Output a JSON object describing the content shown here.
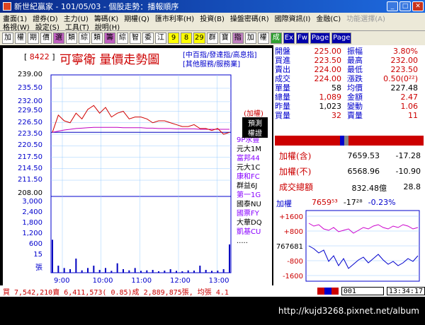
{
  "window": {
    "title": "新世紀贏家 - 101/05/03 - 個股走勢：播報順序"
  },
  "menu": {
    "row1": [
      "畫面(1)",
      "證券(D)",
      "主力(U)",
      "籌碼(K)",
      "期權(Q)",
      "匯市利率(H)",
      "投資(B)",
      "操盤密碼(R)",
      "國際資訊(I)",
      "金融(C)",
      "功能選擇(A)"
    ],
    "row1_dim": "功能選擇(A)",
    "row2": [
      "格視(W)",
      "設定(S)",
      "工具(T)",
      "說明(H)"
    ]
  },
  "toolbar": {
    "buttons": [
      "加",
      "權",
      "期",
      "價",
      "選",
      "類",
      "綜",
      "類",
      "籌",
      "綜",
      "智",
      "委",
      "江",
      "9",
      "8",
      "29",
      "群",
      "寶",
      "指",
      "加",
      "權",
      "成",
      "Ex",
      "Fw",
      "Page",
      "Page"
    ]
  },
  "stock": {
    "code": "8422",
    "name_title": "可寧衛  量價走勢圖",
    "links": [
      "[中百指/發達指/高息指]",
      "[其他服務/服務業]"
    ]
  },
  "chart_data": {
    "type": "line",
    "title": "可寧衛  量價走勢圖",
    "price_ticks": [
      "239.00",
      "235.50",
      "232.00",
      "229.50",
      "226.50",
      "223.50",
      "220.50",
      "217.50",
      "214.50",
      "211.50",
      "208.00"
    ],
    "volume_ticks": [
      "3,000",
      "2,400",
      "1,800",
      "1,200",
      "600",
      "15",
      "張"
    ],
    "x_ticks": [
      "9:00",
      "10:00",
      "11:00",
      "12:00",
      "13:00"
    ],
    "ylim": [
      208,
      239
    ],
    "ref_price": 224,
    "price": [
      224,
      228.5,
      227,
      226.5,
      229,
      227.5,
      230,
      231,
      229,
      230.5,
      228,
      229,
      229.5,
      227.5,
      228,
      228,
      227.5,
      226.5,
      227,
      227,
      226.5,
      226,
      225.5,
      225.5,
      226,
      225,
      225,
      224.5,
      225,
      223.5,
      224
    ],
    "avg": [
      224,
      224.3,
      224.6,
      224.8,
      225.0,
      225.1,
      225.2,
      225.3,
      225.3,
      225.3,
      225.3,
      225.3,
      225.2,
      225.2,
      225.2,
      225.2,
      225.1,
      225.1,
      225.0,
      225.0,
      225.0,
      224.9,
      224.9,
      224.9,
      224.9,
      224.8,
      224.8,
      224.8,
      224.8,
      224.8,
      224.8
    ],
    "volume": [
      1400,
      300,
      200,
      150,
      600,
      100,
      200,
      300,
      120,
      200,
      80,
      400,
      150,
      100,
      200,
      80,
      100,
      120,
      60,
      90,
      150,
      80,
      60,
      100,
      90,
      300,
      120,
      80,
      90,
      150,
      1200
    ],
    "vmax": 3000
  },
  "side_list": [
    "9P永豐",
    "元大1M",
    "富邦44",
    "元大1C",
    "康和FC",
    "群益6J",
    "第一1G",
    "國泰NU",
    "國票FY",
    "大華DQ",
    "凱基CU",
    "....."
  ],
  "side_heads": [
    "(加權)",
    "預測",
    "權證"
  ],
  "quote": [
    [
      "開盤",
      "225.00",
      "振幅",
      "3.80%"
    ],
    [
      "買進",
      "223.50",
      "最高",
      "232.00"
    ],
    [
      "賣出",
      "224.00",
      "最低",
      "223.50"
    ],
    [
      "成交",
      "224.00",
      "漲跌",
      "0.50(0²²)"
    ],
    [
      "單量",
      "58",
      "均價",
      "227.48"
    ],
    [
      "總量",
      "1,089",
      "金額",
      "2.47"
    ],
    [
      "昨量",
      "1,023",
      "變動",
      "1.06"
    ],
    [
      "買量",
      "32",
      "賣量",
      "11"
    ]
  ],
  "index": [
    {
      "label": "加權(含)",
      "v1": "7659.53",
      "v2": "-17.28"
    },
    {
      "label": "加權(不)",
      "v1": "6568.96",
      "v2": "-10.90"
    },
    {
      "label": "成交總額",
      "v1": "832.48億",
      "v2": "28.8"
    }
  ],
  "mini": {
    "label": "加權",
    "value": "7659⁵³",
    "change": "-17²⁸",
    "pct": "-0.23%",
    "ticks": [
      "+1600",
      "+800",
      "767681",
      "-800",
      "-1600"
    ]
  },
  "status": {
    "left": "買 7,542,210賣 6,411,573( 0.85)成 2,889,875張, 均張 4.1",
    "code": "001",
    "time": "13:34:17"
  },
  "footer": "http://kujd3268.pixnet.net/album",
  "colors": {
    "price": "#d00000",
    "avg": "#c000c0",
    "volume": "#0000c0",
    "ref": "#0000c0"
  }
}
